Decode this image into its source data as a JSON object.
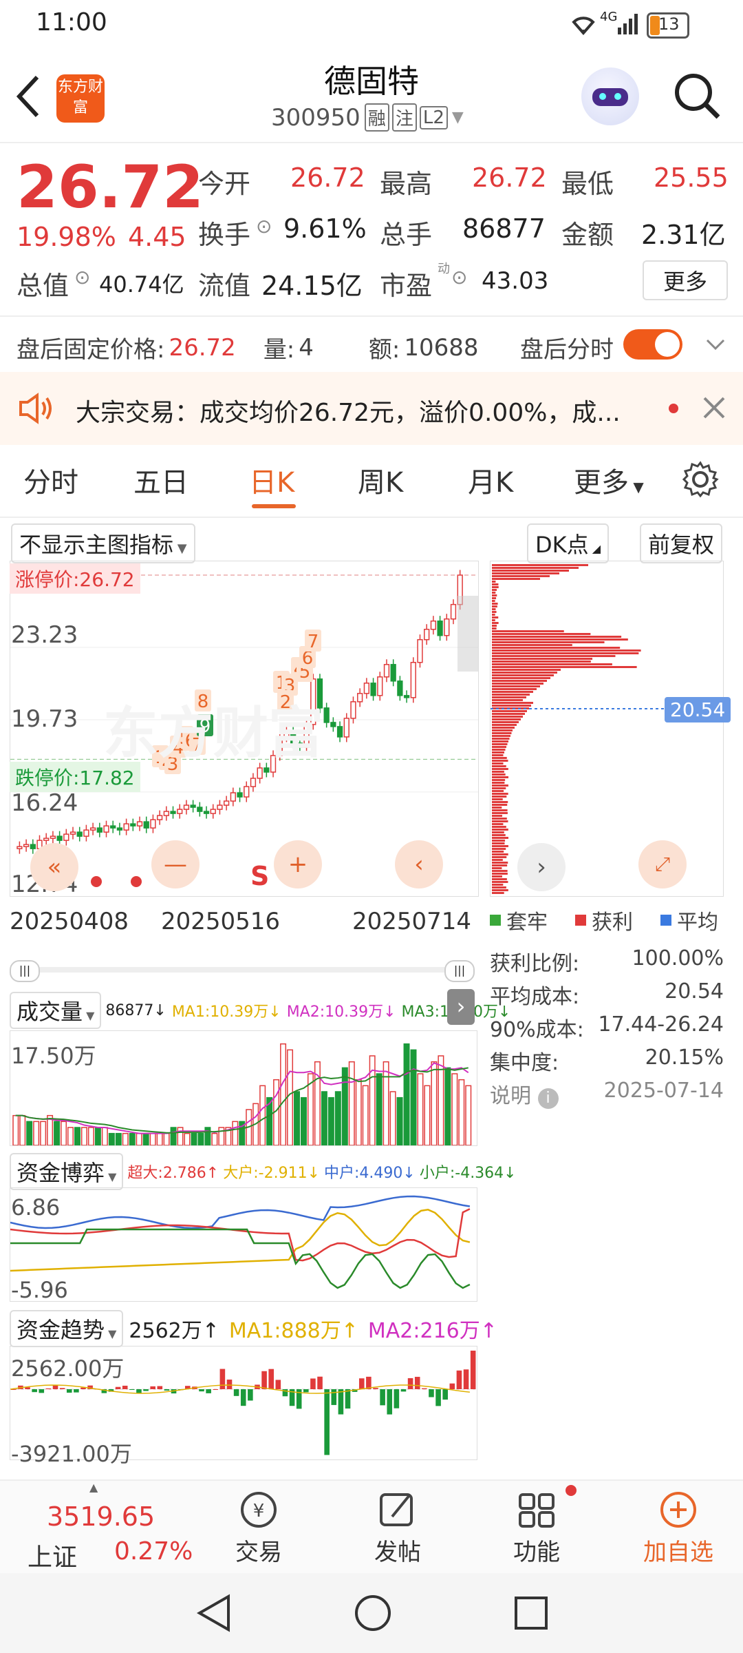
{
  "status": {
    "time": "11:00",
    "network": "4G",
    "battery": "13"
  },
  "header": {
    "logo_text": "东方财富",
    "stock_name": "德固特",
    "stock_code": "300950",
    "badge1": "融",
    "badge2": "注",
    "badge3": "L2"
  },
  "quote": {
    "price": "26.72",
    "change_pct": "19.98%",
    "change_amt": "4.45",
    "open_label": "今开",
    "open": "26.72",
    "high_label": "最高",
    "high": "26.72",
    "low_label": "最低",
    "low": "25.55",
    "turnover_label": "换手",
    "turnover": "9.61%",
    "volume_label": "总手",
    "volume": "86877",
    "amount_label": "金额",
    "amount": "2.31亿",
    "mktcap_label": "总值",
    "mktcap": "40.74亿",
    "float_label": "流值",
    "float": "24.15亿",
    "pe_label": "市盈",
    "pe_sup": "动",
    "pe": "43.03",
    "more_label": "更多"
  },
  "afterhours": {
    "price_label": "盘后固定价格:",
    "price": "26.72",
    "qty_label": "量:",
    "qty": "4",
    "amt_label": "额:",
    "amt": "10688",
    "timeshare_label": "盘后分时"
  },
  "notice": {
    "text": "大宗交易：成交均价26.72元，溢价0.00%，成..."
  },
  "tabs": [
    "分时",
    "五日",
    "日K",
    "周K",
    "月K",
    "更多"
  ],
  "chart_toolbar": {
    "indicator_select": "不显示主图指标",
    "dk_label": "DK点",
    "adjust_label": "前复权"
  },
  "main_chart": {
    "limit_up_label": "涨停价:26.72",
    "limit_down_label": "跌停价:17.82",
    "y_ticks": [
      "23.23",
      "19.73",
      "16.24",
      "12.74"
    ],
    "x_ticks": [
      "20250408",
      "20250516",
      "20250714"
    ],
    "signal_s": "S",
    "watermark": "东方财富",
    "markers": [
      "1",
      "2",
      "3",
      "4",
      "5",
      "6",
      "7",
      "8",
      "9",
      "1",
      "3",
      "2",
      "4",
      "5",
      "6",
      "7"
    ]
  },
  "chip": {
    "avg_label": "20.54",
    "legend": [
      "套牢",
      "获利",
      "平均"
    ],
    "profit_ratio_label": "获利比例:",
    "profit_ratio": "100.00%",
    "avg_cost_label": "平均成本:",
    "avg_cost": "20.54",
    "cost90_label": "90%成本:",
    "cost90": "17.44-26.24",
    "concentration_label": "集中度:",
    "concentration": "20.15%",
    "explain_label": "说明",
    "date": "2025-07-14",
    "colors": {
      "trapped": "#3aa83a",
      "profit": "#e03a3a",
      "avg": "#3a7ae0"
    }
  },
  "volume_panel": {
    "title": "成交量",
    "v": "86877↓",
    "ma1": "MA1:10.39万↓",
    "ma2": "MA2:10.39万↓",
    "ma3": "MA3:10.10万↓",
    "y_label": "17.50万"
  },
  "fund_panel": {
    "title": "资金博弈",
    "super": "超大:2.786↑",
    "big": "大户:-2.911↓",
    "mid": "中户:4.490↓",
    "small": "小户:-4.364↓",
    "y_top": "6.86",
    "y_bottom": "-5.96"
  },
  "trend_panel": {
    "title": "资金趋势",
    "val": "2562万↑",
    "ma1": "MA1:888万↑",
    "ma2": "MA2:216万↑",
    "y_top": "2562.00万",
    "y_bottom": "-3921.00万"
  },
  "bottom_bar": {
    "index_value": "3519.65",
    "index_name": "上证",
    "index_change": "0.27%",
    "items": [
      "交易",
      "发帖",
      "功能",
      "加自选"
    ]
  },
  "chart_data": [
    {
      "type": "candlestick",
      "title": "日K",
      "x_ticks": [
        "20250408",
        "20250516",
        "20250714"
      ],
      "ylim": [
        12.74,
        26.72
      ],
      "y_ticks": [
        23.23,
        19.73,
        16.24,
        12.74
      ],
      "close": [
        13.6,
        13.7,
        13.5,
        13.9,
        14.0,
        14.1,
        13.9,
        14.2,
        14.3,
        14.1,
        14.4,
        14.5,
        14.3,
        14.6,
        14.5,
        14.4,
        14.7,
        14.6,
        14.8,
        14.5,
        14.9,
        15.1,
        15.3,
        15.2,
        15.4,
        15.6,
        15.5,
        15.3,
        15.2,
        15.4,
        15.6,
        15.8,
        16.2,
        16.0,
        16.5,
        16.9,
        17.4,
        17.2,
        18.0,
        18.9,
        19.2,
        18.6,
        18.4,
        19.5,
        21.7,
        20.3,
        19.6,
        19.4,
        18.9,
        19.8,
        20.6,
        21.0,
        21.5,
        20.9,
        21.8,
        22.4,
        21.6,
        20.9,
        20.8,
        22.5,
        23.6,
        24.1,
        24.5,
        23.8,
        24.6,
        25.3,
        26.72
      ]
    },
    {
      "type": "bar",
      "title": "筹码分布",
      "avg_cost": 20.54,
      "profit_ratio": 1.0,
      "cost90": [
        17.44,
        26.24
      ],
      "concentration": 0.2015
    },
    {
      "type": "bar",
      "title": "成交量",
      "ylabel": "17.50万",
      "values": [
        5,
        5,
        4,
        4,
        4,
        5,
        4,
        4,
        3,
        3,
        3,
        3,
        3,
        3,
        2,
        2,
        2,
        2,
        2,
        2,
        2,
        2,
        2,
        3,
        3,
        2,
        2,
        2,
        3,
        2,
        3,
        3,
        4,
        4,
        6,
        7,
        10,
        8,
        11,
        17,
        16,
        9,
        8,
        12,
        14,
        9,
        8,
        9,
        13,
        14,
        11,
        10,
        15,
        12,
        14,
        9,
        8,
        17,
        16,
        12,
        10,
        14,
        15,
        13,
        12,
        11,
        10
      ],
      "series": [
        {
          "name": "MA1"
        },
        {
          "name": "MA2"
        },
        {
          "name": "MA3"
        }
      ]
    },
    {
      "type": "line",
      "title": "资金博弈",
      "ylim": [
        -5.96,
        6.86
      ],
      "series": [
        {
          "name": "超大"
        },
        {
          "name": "大户"
        },
        {
          "name": "中户"
        },
        {
          "name": "小户"
        }
      ]
    },
    {
      "type": "bar",
      "title": "资金趋势",
      "ylim": [
        -3921,
        2562
      ]
    }
  ]
}
